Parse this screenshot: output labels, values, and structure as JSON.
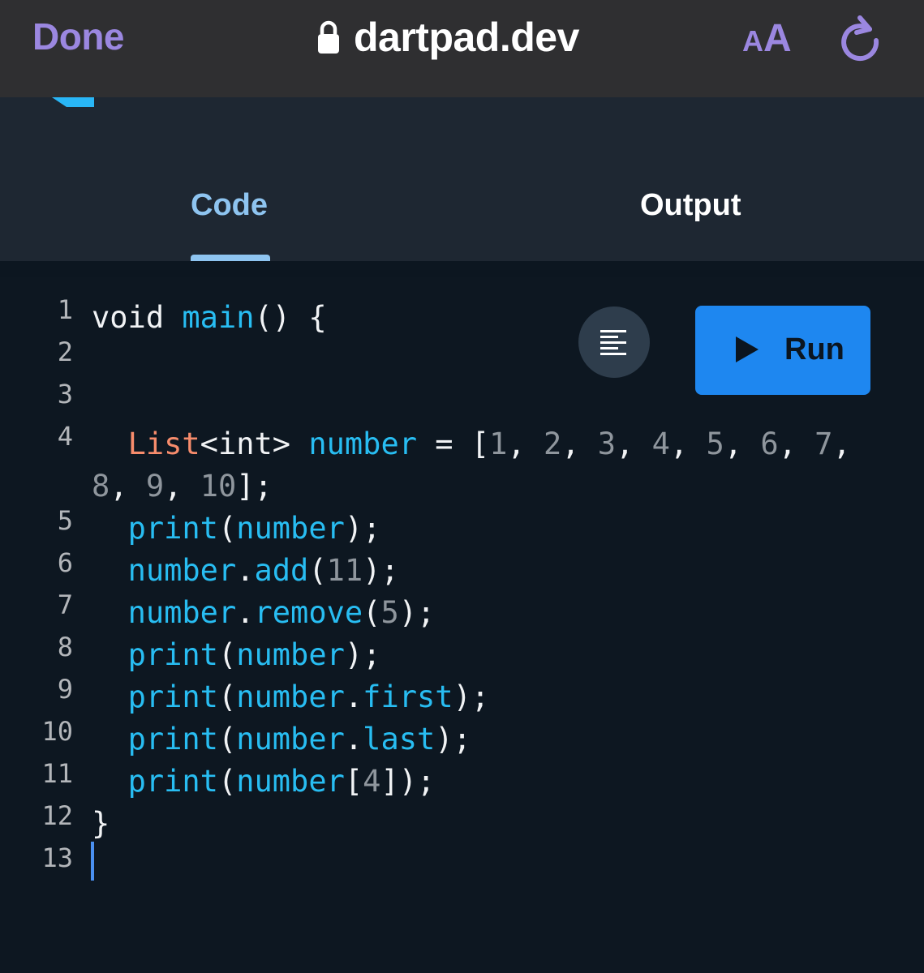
{
  "browser": {
    "done_label": "Done",
    "url": "dartpad.dev",
    "aa_small": "A",
    "aa_big": "A",
    "accent_color": "#9b87e0"
  },
  "tabs": [
    {
      "label": "Code",
      "active": true
    },
    {
      "label": "Output",
      "active": false
    }
  ],
  "toolbar": {
    "run_label": "Run"
  },
  "editor": {
    "line_numbers": [
      "1",
      "2",
      "3",
      "4",
      "5",
      "6",
      "7",
      "8",
      "9",
      "10",
      "11",
      "12",
      "13"
    ],
    "cursor_line": 13
  }
}
